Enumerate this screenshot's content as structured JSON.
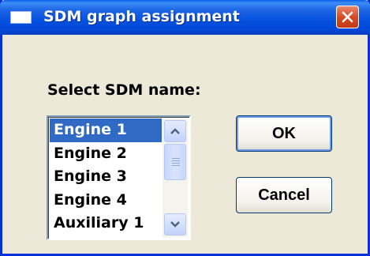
{
  "window": {
    "title": "SDM graph assignment",
    "icon": "window-icon",
    "close_icon": "close-icon",
    "colors": {
      "titlebar": "#0451DF",
      "face": "#ECE9D8",
      "selection": "#316AC5",
      "close": "#D64A24"
    }
  },
  "dialog": {
    "prompt_label": "Select SDM name:",
    "list": {
      "selected_index": 0,
      "items": [
        {
          "label": "Engine 1"
        },
        {
          "label": "Engine 2"
        },
        {
          "label": "Engine 3"
        },
        {
          "label": "Engine 4"
        },
        {
          "label": "Auxiliary 1"
        }
      ]
    },
    "buttons": {
      "ok_label": "OK",
      "cancel_label": "Cancel"
    }
  }
}
